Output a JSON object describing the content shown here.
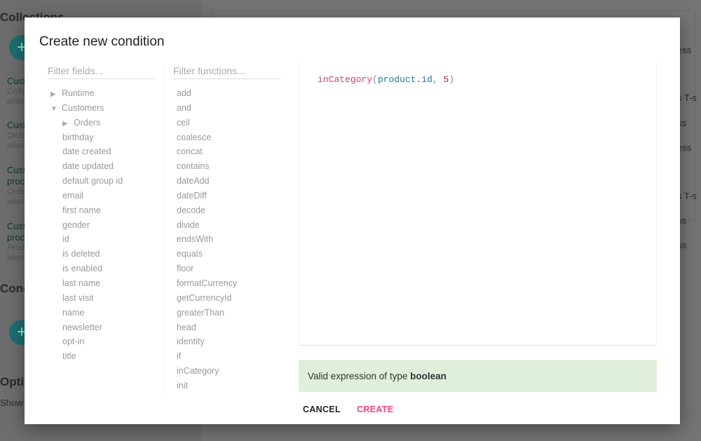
{
  "background": {
    "collections_heading": "Collections",
    "items": [
      {
        "title": "Cust",
        "sub": "Colle",
        "alias": "alias"
      },
      {
        "title": "Cust",
        "sub": "Orde",
        "alias": "alias"
      },
      {
        "title": "Cust",
        "title2": "proc",
        "sub": "Orde",
        "alias": "alias"
      },
      {
        "title": "Cust",
        "title2": "proc",
        "sub": "Prod",
        "alias": "alias"
      }
    ],
    "conditions_heading": "Cond",
    "options_heading": "Opti",
    "show_label": "Show",
    "right_fragments": [
      "ess",
      "s T-s",
      "ss",
      "ess",
      "s T-s",
      "ss",
      "ss"
    ]
  },
  "dialog": {
    "title": "Create new condition",
    "fields_placeholder": "Filter fields...",
    "functions_placeholder": "Filter functions...",
    "fields": [
      {
        "label": "Runtime",
        "toggle": "collapsed",
        "level": 0
      },
      {
        "label": "Customers",
        "toggle": "expanded",
        "level": 0
      },
      {
        "label": "Orders",
        "toggle": "collapsed",
        "level": 1
      },
      {
        "label": "birthday",
        "level": 1
      },
      {
        "label": "date created",
        "level": 1
      },
      {
        "label": "date updated",
        "level": 1
      },
      {
        "label": "default group id",
        "level": 1
      },
      {
        "label": "email",
        "level": 1
      },
      {
        "label": "first name",
        "level": 1
      },
      {
        "label": "gender",
        "level": 1
      },
      {
        "label": "id",
        "level": 1
      },
      {
        "label": "is deleted",
        "level": 1
      },
      {
        "label": "is enabled",
        "level": 1
      },
      {
        "label": "last name",
        "level": 1
      },
      {
        "label": "last visit",
        "level": 1
      },
      {
        "label": "name",
        "level": 1
      },
      {
        "label": "newsletter",
        "level": 1
      },
      {
        "label": "opt-in",
        "level": 1
      },
      {
        "label": "title",
        "level": 1
      }
    ],
    "functions": [
      "add",
      "and",
      "ceil",
      "coalesce",
      "concat",
      "contains",
      "dateAdd",
      "dateDiff",
      "decode",
      "divide",
      "endsWith",
      "equals",
      "floor",
      "formatCurrency",
      "getCurrencyId",
      "greaterThan",
      "head",
      "identity",
      "if",
      "inCategory",
      "init"
    ],
    "expression": {
      "fn": "inCategory",
      "open": "(",
      "arg1": "product.id",
      "sep": ", ",
      "arg2": "5",
      "close": ")"
    },
    "validation": {
      "prefix": "Valid expression of type ",
      "type": "boolean"
    },
    "cancel_label": "CANCEL",
    "create_label": "CREATE",
    "colors": {
      "accent": "#ff4081",
      "valid_bg": "#e0efda"
    }
  }
}
